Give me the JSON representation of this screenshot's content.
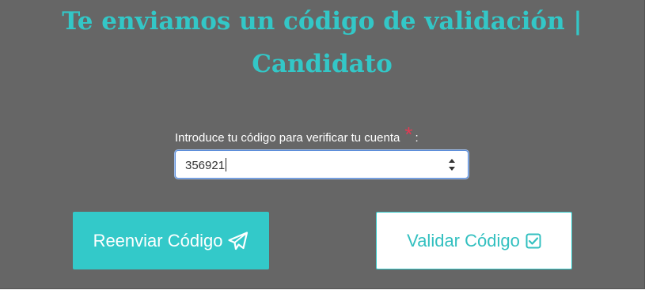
{
  "header": {
    "title_line1": "Te enviamos un código de validación |",
    "title_line2": "Candidato"
  },
  "form": {
    "code_label": "Introduce tu código para verificar tu cuenta",
    "required_mark": "*",
    "label_suffix": ":",
    "code_value": "356921"
  },
  "actions": {
    "resend_label": "Reenviar Código",
    "resend_icon": "paper-plane-icon",
    "validate_label": "Validar Código",
    "validate_icon": "check-square-icon"
  },
  "colors": {
    "accent": "#33c9c9",
    "panel_background": "#666666",
    "required": "#e23b54"
  }
}
